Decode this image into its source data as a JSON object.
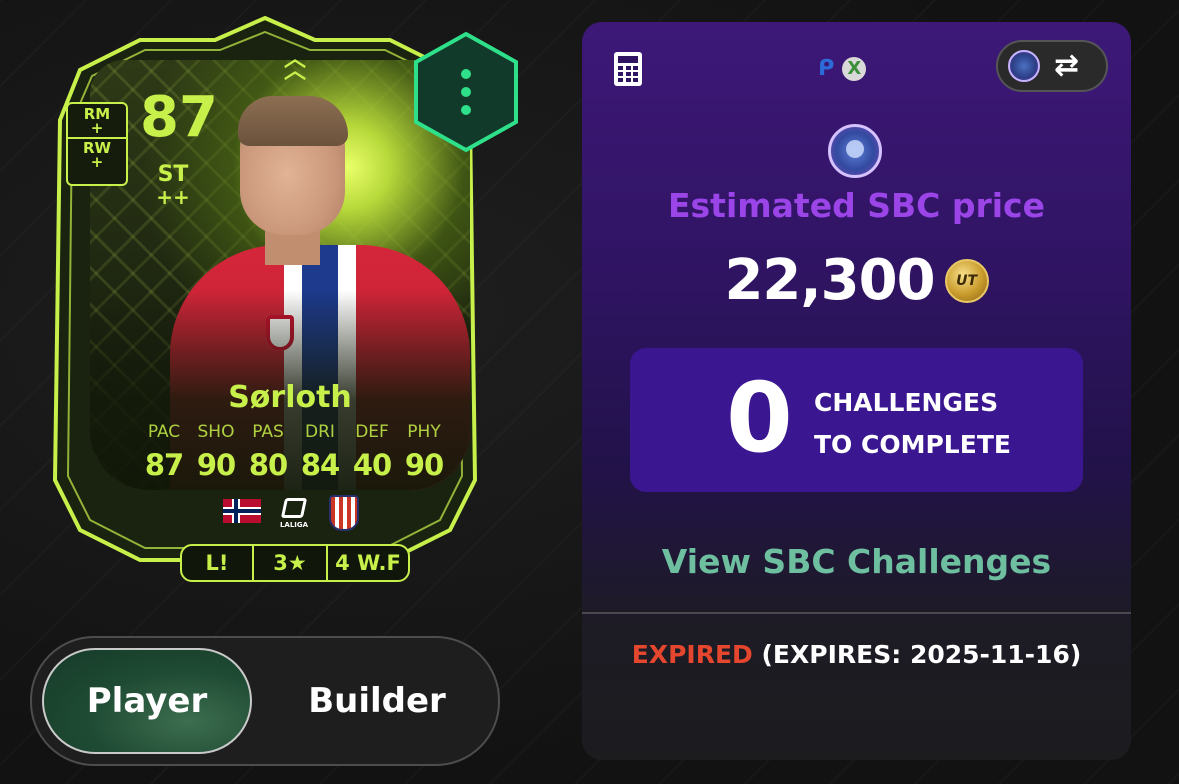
{
  "card": {
    "rating": "87",
    "position": "ST",
    "position_plus": "++",
    "alt_positions": [
      "RM",
      "RW"
    ],
    "alt_plus": "+",
    "name": "Sørloth",
    "stat_labels": [
      "PAC",
      "SHO",
      "PAS",
      "DRI",
      "DEF",
      "PHY"
    ],
    "stat_values": [
      "87",
      "90",
      "80",
      "84",
      "40",
      "90"
    ],
    "league_text": "LALIGA",
    "traits": [
      "L!",
      "3★",
      "4 W.F"
    ],
    "icons": [
      "norway-flag",
      "laliga-logo",
      "atletico-madrid-crest",
      "chevron-up-icon",
      "more-vertical-icon"
    ],
    "accent_color": "#c8f04a"
  },
  "toggle": {
    "options": [
      "Player",
      "Builder"
    ],
    "selected": "Player"
  },
  "panel": {
    "icons": [
      "calculator-icon",
      "playstation-icon",
      "xbox-icon",
      "sbc-badge-icon",
      "swap-icon",
      "coin-icon"
    ],
    "estimated_label": "Estimated SBC price",
    "price": "22,300",
    "coin_label": "UT",
    "challenges_count": "0",
    "challenges_line1": "CHALLENGES",
    "challenges_line2": "TO COMPLETE",
    "view_link": "View SBC Challenges",
    "expired": "EXPIRED",
    "expires_text": "(EXPIRES: 2025-11-16)",
    "colors": {
      "estimated_label": "#9b45e8",
      "view_link": "#6dbfa0",
      "expired": "#e4462e"
    }
  }
}
